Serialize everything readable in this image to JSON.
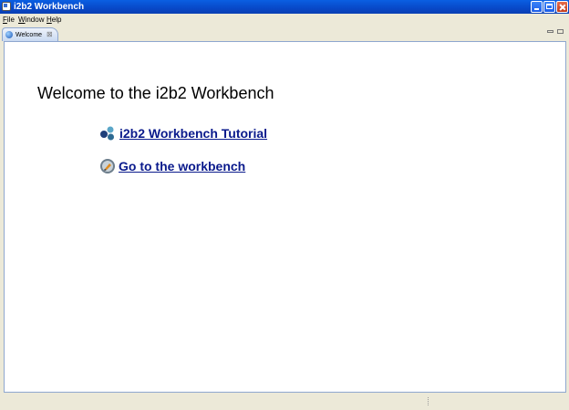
{
  "window": {
    "title": "i2b2 Workbench"
  },
  "menu": {
    "items": [
      "File",
      "Window",
      "Help"
    ]
  },
  "editor_tabs": [
    {
      "label": "Welcome",
      "active": true
    }
  ],
  "welcome_page": {
    "heading": "Welcome to the i2b2 Workbench",
    "links": [
      {
        "label": "i2b2 Workbench Tutorial",
        "icon": "tutorial-icon"
      },
      {
        "label": "Go to the workbench",
        "icon": "workbench-icon"
      }
    ]
  },
  "colors": {
    "titlebar": "#0848c8",
    "link": "#0a1a8c",
    "chrome": "#ece9d8"
  }
}
